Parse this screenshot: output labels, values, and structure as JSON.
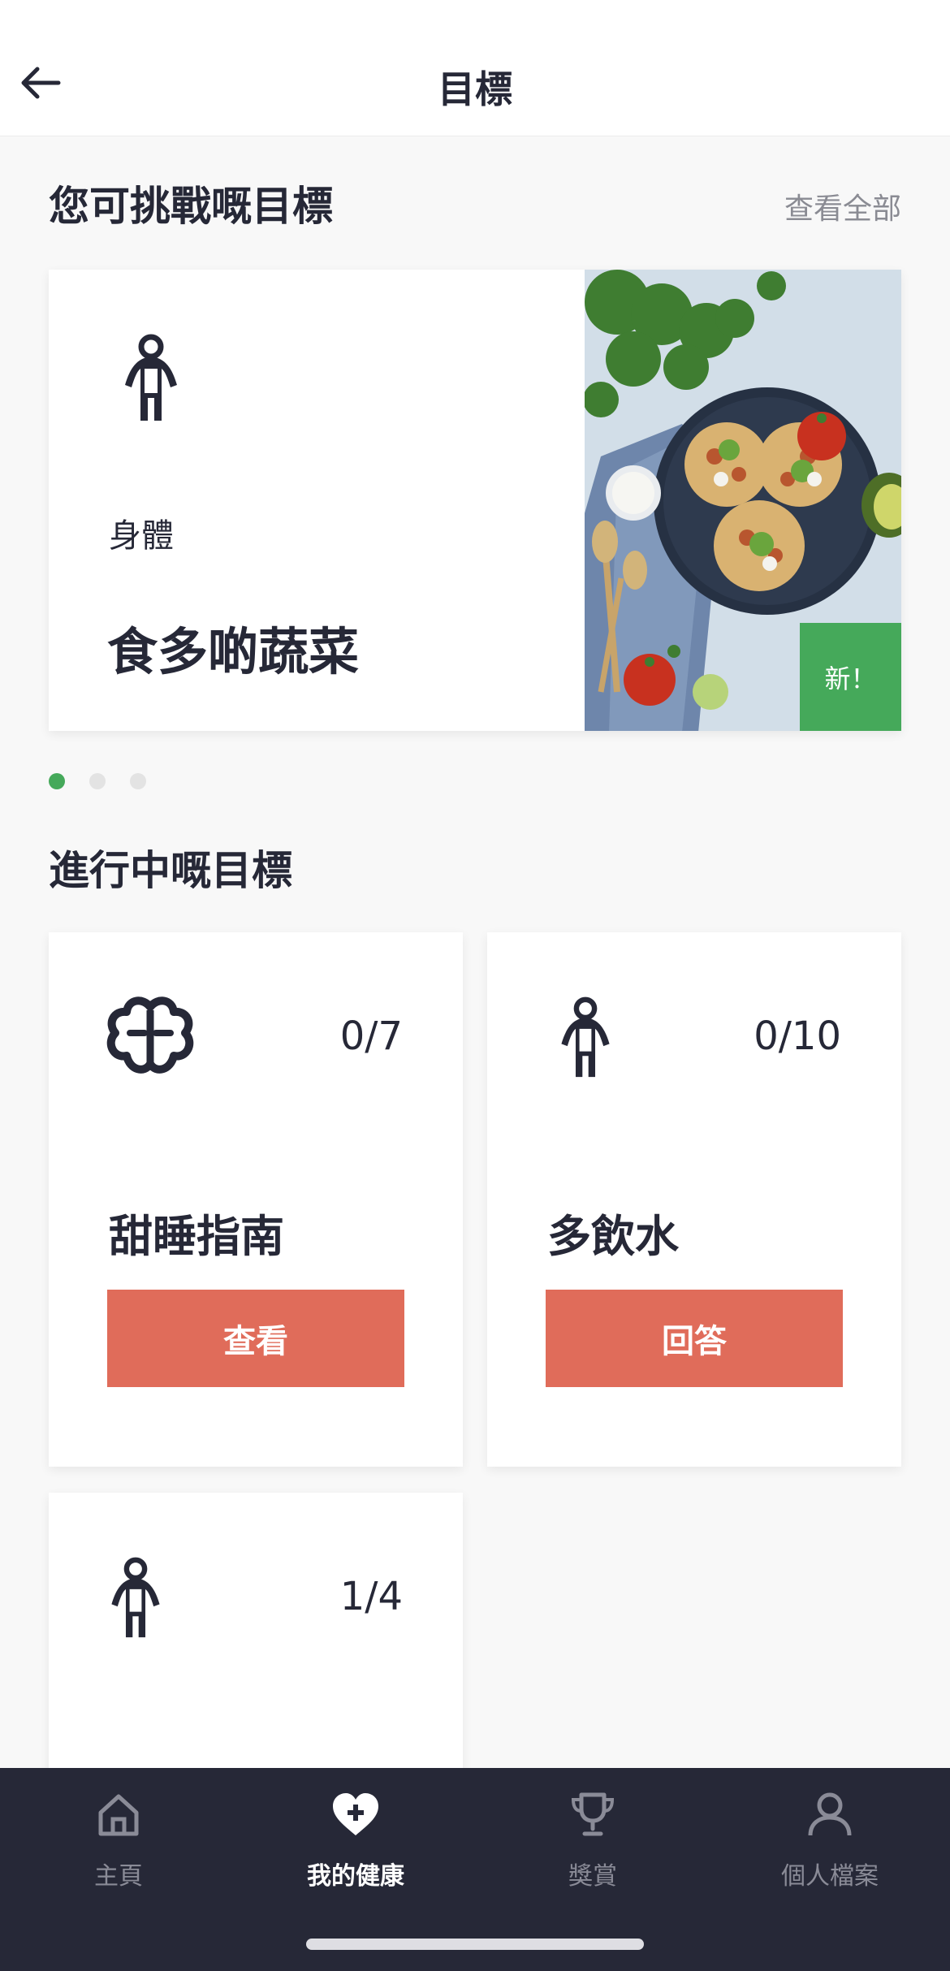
{
  "header": {
    "title": "目標",
    "back_icon": "arrow-left-icon"
  },
  "challenge_section": {
    "title": "您可挑戰嘅目標",
    "view_all_label": "查看全部",
    "featured": {
      "icon": "body-icon",
      "category": "身體",
      "title": "食多啲蔬菜",
      "badge": "新！"
    },
    "carousel": {
      "page_count": 3,
      "active_index": 0,
      "active_color": "#45a95a",
      "inactive_color": "#e3e3e3"
    }
  },
  "active_section": {
    "title": "進行中嘅目標",
    "goals": [
      {
        "icon": "brain-icon",
        "progress": "0/7",
        "title": "甜睡指南",
        "button_label": "查看"
      },
      {
        "icon": "body-icon",
        "progress": "0/10",
        "title": "多飲水",
        "button_label": "回答"
      },
      {
        "icon": "body-icon",
        "progress": "1/4"
      }
    ]
  },
  "tab_bar": {
    "tabs": [
      {
        "icon": "home-icon",
        "label": "主頁",
        "active": false
      },
      {
        "icon": "heart-plus-icon",
        "label": "我的健康",
        "active": true
      },
      {
        "icon": "trophy-icon",
        "label": "獎賞",
        "active": false
      },
      {
        "icon": "person-icon",
        "label": "個人檔案",
        "active": false
      }
    ]
  },
  "colors": {
    "accent_button": "#e06c5a",
    "badge_green": "#45a95a",
    "tab_bar_background": "#262837",
    "text_primary": "#262837",
    "page_background": "#f8f8f8"
  }
}
